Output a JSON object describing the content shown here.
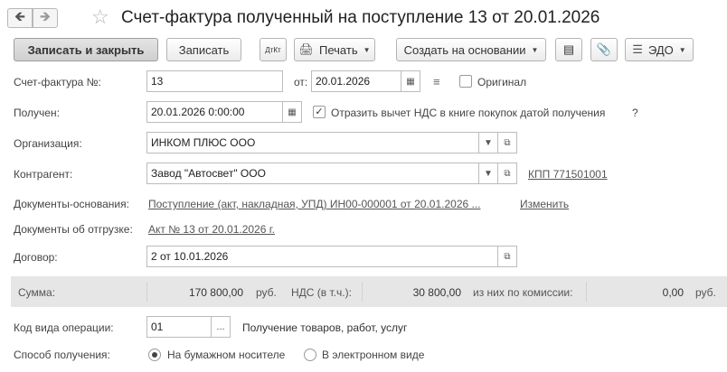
{
  "window": {
    "title": "Счет-фактура полученный на поступление 13 от 20.01.2026",
    "back_icon": "arrow-left-icon",
    "forward_icon": "arrow-right-icon",
    "favorite_icon": "star-icon"
  },
  "toolbar": {
    "save_close": "Записать и закрыть",
    "save": "Записать",
    "dt_kt": "ДтКт",
    "print": "Печать",
    "create_based": "Создать на основании",
    "edo": "ЭДО"
  },
  "form": {
    "invoice_label": "Счет-фактура №:",
    "invoice_number": "13",
    "from_label": "от:",
    "invoice_date": "20.01.2026",
    "original_label": "Оригинал",
    "original_checked": false,
    "received_label": "Получен:",
    "received_datetime": "20.01.2026  0:00:00",
    "vat_reflect_label": "Отразить вычет НДС в книге покупок датой получения",
    "vat_reflect_checked": true,
    "help_mark": "?",
    "org_label": "Организация:",
    "org_value": "ИНКОМ ПЛЮС ООО",
    "contractor_label": "Контрагент:",
    "contractor_value": "Завод \"Автосвет\" ООО",
    "kpp_link": "КПП 771501001",
    "base_docs_label": "Документы-основания:",
    "base_docs_link": "Поступление (акт, накладная, УПД) ИН00-000001 от 20.01.2026 ...",
    "change_link": "Изменить",
    "shipment_docs_label": "Документы об отгрузке:",
    "shipment_docs_link": "Акт № 13 от 20.01.2026 г.",
    "contract_label": "Договор:",
    "contract_value": "2 от 10.01.2026"
  },
  "totals": {
    "sum_label": "Сумма:",
    "sum_value": "170 800,00",
    "sum_currency": "руб.",
    "vat_label": "НДС (в т.ч.):",
    "vat_value": "30 800,00",
    "commission_label": "из них по комиссии:",
    "commission_value": "0,00",
    "commission_currency": "руб."
  },
  "operation": {
    "code_label": "Код вида операции:",
    "code_value": "01",
    "code_select": "...",
    "code_description": "Получение товаров, работ, услуг",
    "method_label": "Способ получения:",
    "method_paper": "На бумажном носителе",
    "method_electronic": "В электронном виде",
    "method_selected": "paper"
  }
}
